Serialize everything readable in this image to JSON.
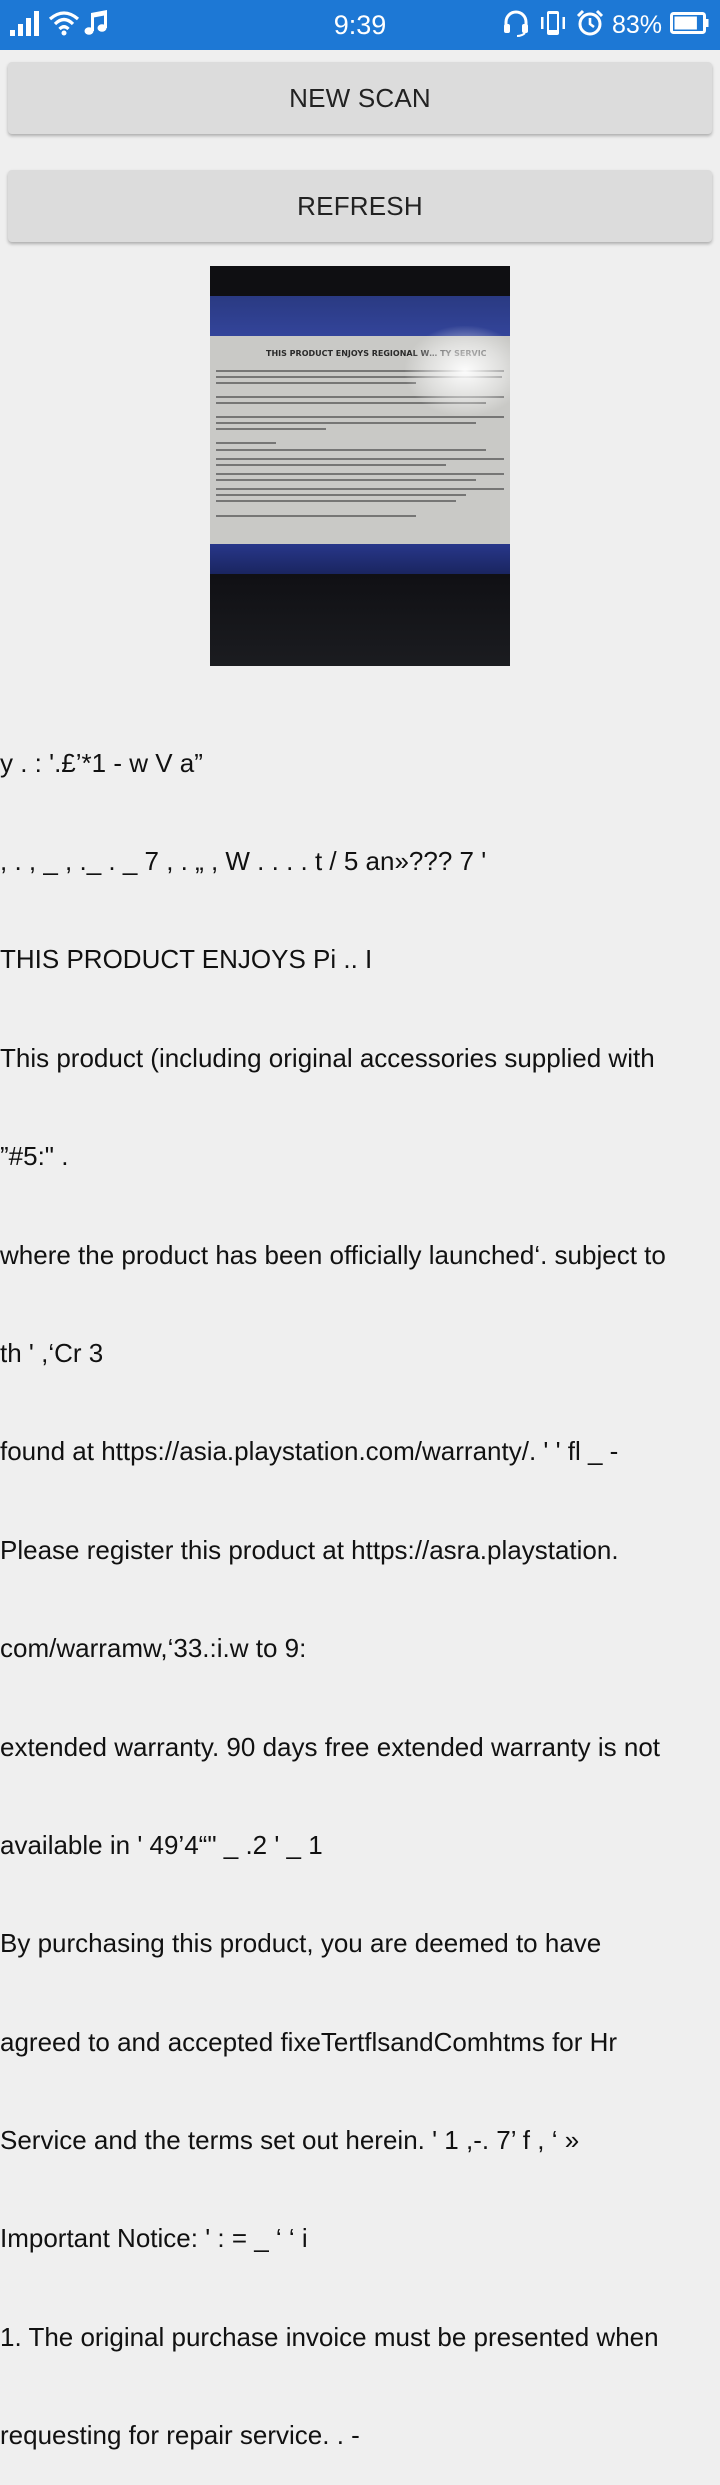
{
  "status_bar": {
    "time": "9:39",
    "battery_percent": "83%",
    "battery_level": 0.83,
    "icons_left": [
      "signal-icon",
      "wifi-icon",
      "music-note-icon"
    ],
    "icons_right": [
      "headset-icon",
      "vibrate-icon",
      "alarm-icon",
      "battery-icon"
    ]
  },
  "buttons": {
    "new_scan": "NEW SCAN",
    "refresh": "REFRESH"
  },
  "photo": {
    "sheet_title": "THIS PRODUCT ENJOYS REGIONAL W…   TY SERVIC"
  },
  "ocr_lines": [
    "y . : '.£’*1 - w V a”",
    ", . , _ , ._ . _ 7 , . „ , W . . . . t / 5 an»??? 7 '",
    "THIS PRODUCT ENJOYS Pi .. I",
    "This product (including original accessories supplied with",
    "”#5:\" .",
    "where the product has been officially launched‘. subject to",
    "th ' ,‘Cr 3",
    "found at https://asia.playstation.com/warranty/. ' ' fl _ -",
    "Please register this product at https://asra.playstation.",
    "com/warramw,‘33.:i.w to 9:",
    "extended warranty. 90 days free extended warranty is not",
    "available in ' 49’4“\" _ .2 ' _ 1",
    "By purchasing this product, you are deemed to have",
    "agreed to and accepted fixeTertflsandComhtms for Hr",
    "Service and the terms set out herein. ' 1 ,-. 7’ f , ‘ »",
    "Important Notice: ' : = _ ‘ ‘ i",
    "1. The original purchase invoice must be presented when",
    "requesting for repair service. . -"
  ]
}
